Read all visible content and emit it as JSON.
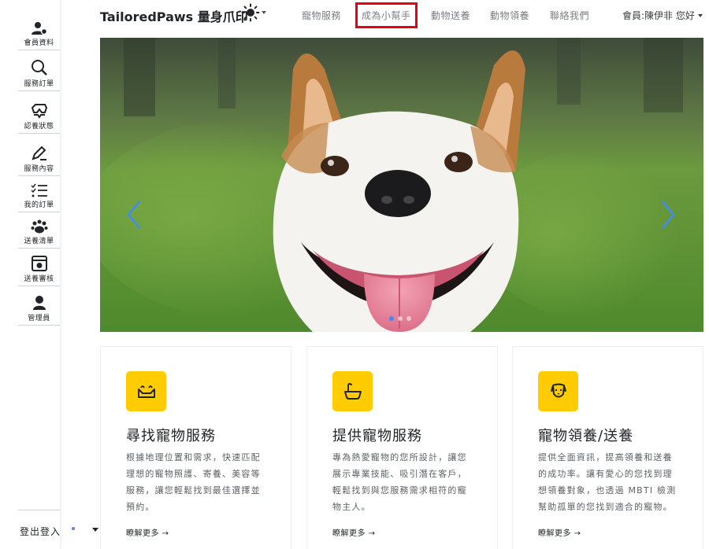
{
  "brand": "TailoredPaws 量身爪印",
  "nav": {
    "links": [
      "寵物服務",
      "成為小幫手",
      "動物送養",
      "動物領養",
      "聯絡我們"
    ],
    "member": "會員:陳伊非 您好"
  },
  "sidebar": {
    "items": [
      {
        "label": "會員資料",
        "icon": "user-gear-icon"
      },
      {
        "label": "服務訂單",
        "icon": "search-icon"
      },
      {
        "label": "認養狀態",
        "icon": "adopt-status-icon"
      },
      {
        "label": "服務內容",
        "icon": "edit-pen-icon"
      },
      {
        "label": "我的訂單",
        "icon": "list-check-icon"
      },
      {
        "label": "送養清單",
        "icon": "paw-icon"
      },
      {
        "label": "送養審核",
        "icon": "review-eye-icon"
      },
      {
        "label": "管理員",
        "icon": "admin-user-icon"
      }
    ],
    "login": "登出登入"
  },
  "carousel": {
    "slides": 3,
    "active_index": 0
  },
  "cards": [
    {
      "title": "尋找寵物服務",
      "body": "根據地理位置和需求，快速匹配理想的寵物照護、寄養、美容等服務，讓您輕鬆找到最佳選擇並預約。",
      "link": "瞭解更多 →",
      "icon": "pet-bed-icon"
    },
    {
      "title": "提供寵物服務",
      "body": "專為熱愛寵物的您所設計，讓您展示專業技能、吸引潛在客戶，輕鬆找到與您服務需求相符的寵物主人。",
      "link": "瞭解更多 →",
      "icon": "bathtub-icon"
    },
    {
      "title": "寵物領養/送養",
      "body": "提供全面資訊，提高領養和送養的成功率。讓有愛心的您找到理想領養對象，也透過 MBTI 檢測幫助孤單的您找到適合的寵物。",
      "link": "瞭解更多 →",
      "icon": "dog-face-icon"
    }
  ],
  "colors": {
    "accent": "#fecc00",
    "highlight": "#e60012",
    "carousel_arrow": "#3d8bfd"
  }
}
